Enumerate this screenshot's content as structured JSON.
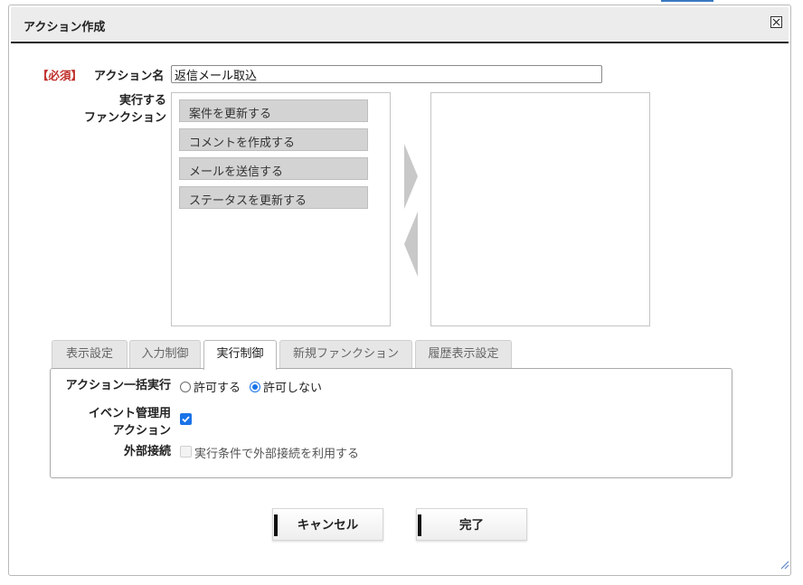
{
  "dialog": {
    "title": "アクション作成",
    "close_icon": "close-icon"
  },
  "form": {
    "required_label": "【必須】",
    "action_name_label": "アクション名",
    "action_name_value": "返信メール取込",
    "function_label_line1": "実行する",
    "function_label_line2": "ファンクション",
    "available_functions": [
      {
        "label": "案件を更新する"
      },
      {
        "label": "コメントを作成する"
      },
      {
        "label": "メールを送信する"
      },
      {
        "label": "ステータスを更新する"
      }
    ],
    "selected_functions": [],
    "move_right_icon": "triangle-right-icon",
    "move_left_icon": "triangle-left-icon"
  },
  "tabs": [
    {
      "label": "表示設定",
      "active": false
    },
    {
      "label": "入力制御",
      "active": false
    },
    {
      "label": "実行制御",
      "active": true
    },
    {
      "label": "新規ファンクション",
      "active": false
    },
    {
      "label": "履歴表示設定",
      "active": false
    }
  ],
  "execution_panel": {
    "bulk_label": "アクション一括実行",
    "allow_label": "許可する",
    "disallow_label": "許可しない",
    "bulk_selected": "許可しない",
    "event_label_line1": "イベント管理用",
    "event_label_line2": "アクション",
    "event_checked": true,
    "external_label": "外部接続",
    "external_option_label": "実行条件で外部接続を利用する",
    "external_checked": false,
    "external_disabled": true
  },
  "buttons": {
    "cancel_label": "キャンセル",
    "done_label": "完了"
  },
  "colors": {
    "required": "#c0302c",
    "accent": "#1a73e8",
    "item_bg": "#d3d3d3",
    "arrow": "#c8c8c8"
  }
}
